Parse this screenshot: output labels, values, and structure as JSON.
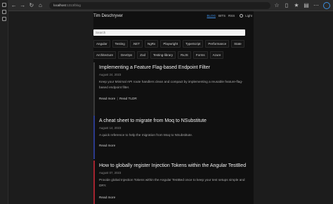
{
  "browser": {
    "url_host": "localhost",
    "url_rest": ":1313/blog"
  },
  "site": {
    "title": "Tim Deschryver",
    "nav": {
      "blog": "BLOG",
      "bits": "BITS",
      "rss": "RSS",
      "light": "Light"
    },
    "search_placeholder": "Search"
  },
  "tags": [
    "Angular",
    "Testing",
    ".NET",
    "NgRx",
    "Playwright",
    "TypeScript",
    "Performance",
    "State",
    "Architecture",
    "DevOps",
    "Zod",
    "Testing-library",
    "RxJS",
    "Forms",
    "Azure"
  ],
  "posts": [
    {
      "title": "Implementing a Feature Flag-based Endpoint Filter",
      "date": "August 24, 2023",
      "excerpt": "Keep your Minimal API route handlers clean and compact by implementing a reusable feature-flag-based endpoint filter.",
      "read_more": "Read more",
      "separator": "|",
      "tldr": "Read TLDR",
      "accent": "#3a3a3a"
    },
    {
      "title": "A cheat sheet to migrate from Moq to NSubstitute",
      "date": "August 14, 2023",
      "excerpt": "A quick reference to help the migration from Moq to NSubstitute.",
      "read_more": "Read more",
      "accent": "#2b3a8c"
    },
    {
      "title": "How to globally register Injection Tokens within the Angular TestBed",
      "date": "August 07, 2023",
      "excerpt": "Provide global Injection Tokens within the Angular TestBed once to keep your test setups simple and DRY.",
      "read_more": "Read more",
      "accent": "#a3232f"
    }
  ]
}
